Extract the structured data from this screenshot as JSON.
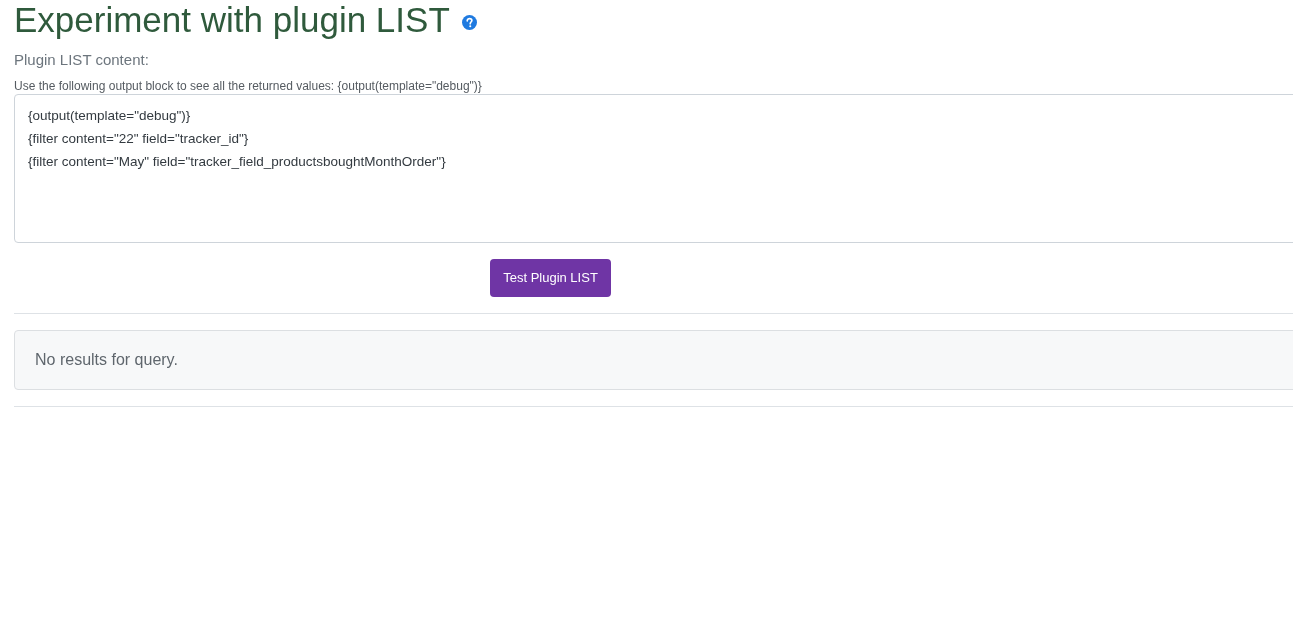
{
  "page": {
    "title": "Experiment with plugin LIST"
  },
  "form": {
    "label": "Plugin LIST content:",
    "hint": "Use the following output block to see all the returned values: {output(template=\"debug\")}",
    "content": {
      "lines": [
        "{output(template=\"debug\")}",
        "{filter content=\"22\" field=\"tracker_id\"}",
        "{filter content=\"May\" field=\"tracker_field_productsboughtMonthOrder\"}"
      ]
    }
  },
  "button": {
    "label": "Test Plugin LIST"
  },
  "results": {
    "message": "No results for query."
  }
}
